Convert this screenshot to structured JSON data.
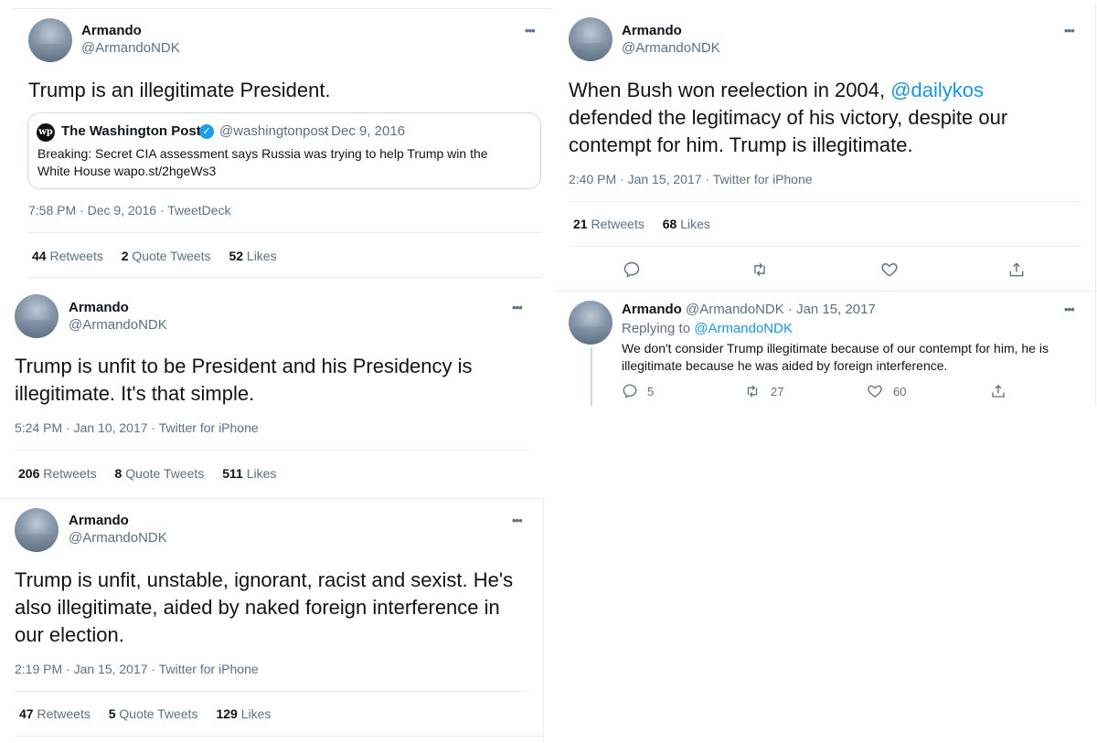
{
  "colors": {
    "link": "#1b95e0",
    "secondary": "#5b7083",
    "primary": "#0f1419",
    "verified": "#1d9bf0"
  },
  "icons": [
    "more-icon",
    "reply-icon",
    "retweet-icon",
    "like-icon",
    "share-icon",
    "verified-icon",
    "washington-post-logo"
  ],
  "tweets": [
    {
      "name": "Armando",
      "handle": "@ArmandoNDK",
      "text": "Trump is an illegitimate President.",
      "quote": {
        "logo_text": "wp",
        "name": "The Washington Post",
        "handle": "@washingtonpost",
        "date": "· Dec 9, 2016",
        "line1": "Breaking: Secret CIA assessment says Russia was trying to help Trump win the",
        "line2": "White House wapo.st/2hgeWs3"
      },
      "meta": "7:58 PM · Dec 9, 2016 · TweetDeck",
      "retweets": "44",
      "retweets_label": "Retweets",
      "quotes": "2",
      "quotes_label": "Quote Tweets",
      "likes": "52",
      "likes_label": "Likes"
    },
    {
      "name": "Armando",
      "handle": "@ArmandoNDK",
      "text_pre": "When Bush won reelection in 2004, ",
      "text_link": "@dailykos",
      "text_line2": "defended the legitimacy of his victory, despite our",
      "text_line3": "contempt for him. Trump is illegitimate.",
      "meta": "2:40 PM · Jan 15, 2017 · Twitter for iPhone",
      "retweets": "21",
      "retweets_label": "Retweets",
      "likes": "68",
      "likes_label": "Likes"
    },
    {
      "name": "Armando",
      "handle": "@ArmandoNDK",
      "line1": "Trump is unfit to be President and his Presidency is",
      "line2": "illegitimate. It's that simple.",
      "meta": "5:24 PM · Jan 10, 2017 · Twitter for iPhone",
      "retweets": "206",
      "retweets_label": "Retweets",
      "quotes": "8",
      "quotes_label": "Quote Tweets",
      "likes": "511",
      "likes_label": "Likes"
    },
    {
      "name": "Armando",
      "handle": "@ArmandoNDK",
      "line1": "Trump is unfit, unstable, ignorant, racist and sexist. He's",
      "line2": "also illegitimate, aided by naked foreign interference in",
      "line3": "our election.",
      "meta": "2:19 PM · Jan 15, 2017 · Twitter for iPhone",
      "retweets": "47",
      "retweets_label": "Retweets",
      "quotes": "5",
      "quotes_label": "Quote Tweets",
      "likes": "129",
      "likes_label": "Likes"
    }
  ],
  "reply": {
    "name": "Armando",
    "handle_date": "@ArmandoNDK · Jan 15, 2017",
    "replying_prefix": "Replying to ",
    "replying_handle": "@ArmandoNDK",
    "line1": "We don't consider Trump illegitimate because of our contempt for him, he is",
    "line2": "illegitimate because he was aided by foreign interference.",
    "replies": "5",
    "retweets": "27",
    "likes": "60"
  }
}
